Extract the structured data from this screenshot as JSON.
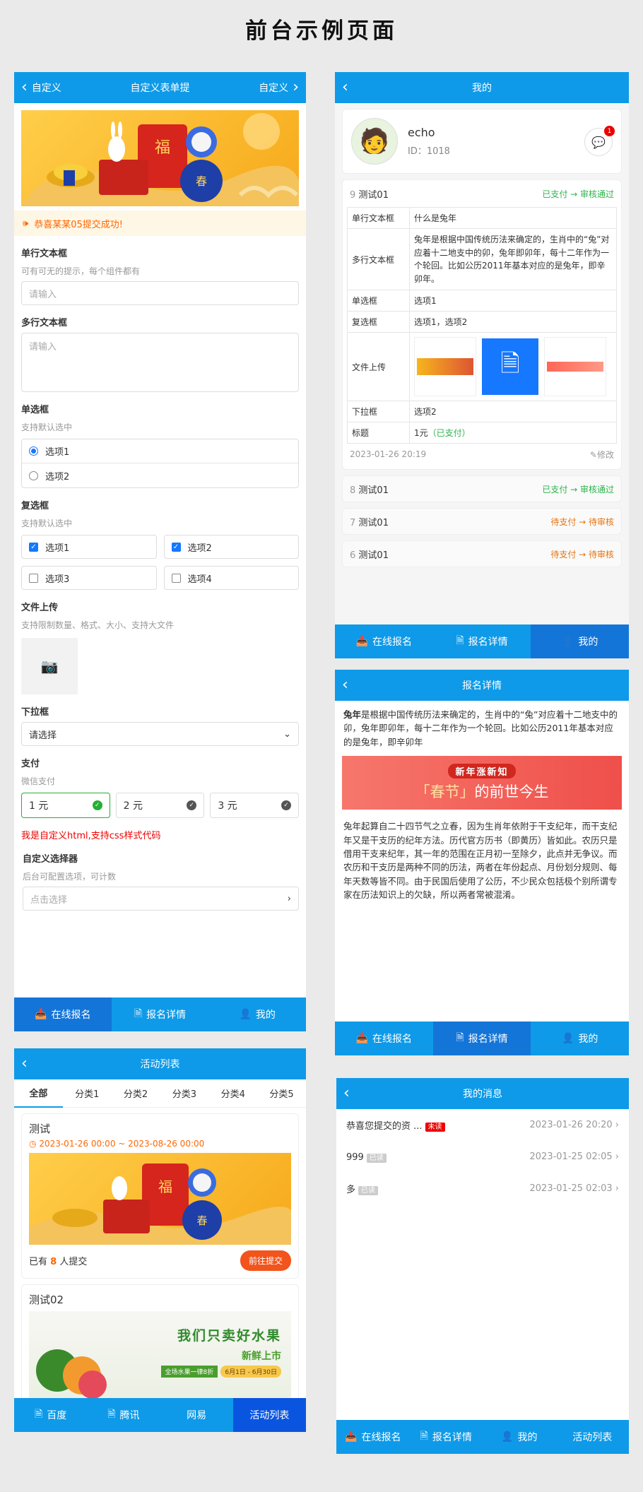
{
  "page_title": "前台示例页面",
  "form": {
    "back_label": "自定义",
    "title": "自定义表单提",
    "right_label": "自定义",
    "notice": "恭喜某某05提交成功!",
    "single_label": "单行文本框",
    "single_hint": "可有可无的提示，每个组件都有",
    "single_placeholder": "请输入",
    "multi_label": "多行文本框",
    "multi_placeholder": "请输入",
    "radio_label": "单选框",
    "radio_hint": "支持默认选中",
    "radio_options": [
      "选项1",
      "选项2"
    ],
    "check_label": "复选框",
    "check_hint": "支持默认选中",
    "check_options": [
      "选项1",
      "选项2",
      "选项3",
      "选项4"
    ],
    "upload_label": "文件上传",
    "upload_hint": "支持限制数量、格式、大小、支持大文件",
    "select_label": "下拉框",
    "select_placeholder": "请选择",
    "pay_label": "支付",
    "pay_hint": "微信支付",
    "pay_options": [
      "1 元",
      "2 元",
      "3 元"
    ],
    "custom_html": "我是自定义html,支持css样式代码",
    "picker_label": "自定义选择器",
    "picker_hint": "后台可配置选项，可计数",
    "picker_placeholder": "点击选择",
    "tabbar": [
      "在线报名",
      "报名详情",
      "我的"
    ]
  },
  "mine": {
    "title": "我的",
    "user_name": "echo",
    "user_id": "ID：1018",
    "msg_badge": "1",
    "entry1": {
      "num": "9",
      "name": "测试01",
      "status": "已支付 → 审核通过",
      "rows": [
        {
          "k": "单行文本框",
          "v": "什么是兔年"
        },
        {
          "k": "多行文本框",
          "v": "兔年是根据中国传统历法来确定的，生肖中的“兔”对应着十二地支中的卯，兔年即卯年，每十二年作为一个轮回。比如公历2011年基本对应的是兔年，即辛卯年。"
        },
        {
          "k": "单选框",
          "v": "选项1"
        },
        {
          "k": "复选框",
          "v": "选项1，选项2"
        },
        {
          "k": "文件上传",
          "v": ""
        },
        {
          "k": "下拉框",
          "v": "选项2"
        },
        {
          "k": "标题",
          "v": "1元",
          "extra": "（已支付）"
        }
      ],
      "date": "2023-01-26 20:19",
      "edit": "修改"
    },
    "entries": [
      {
        "num": "8",
        "name": "测试01",
        "status": "已支付 → 审核通过",
        "color": "green"
      },
      {
        "num": "7",
        "name": "测试01",
        "status": "待支付 → 待审核",
        "color": "orange"
      },
      {
        "num": "6",
        "name": "测试01",
        "status": "待支付 → 待审核",
        "color": "orange"
      }
    ],
    "tabbar": [
      "在线报名",
      "报名详情",
      "我的"
    ]
  },
  "detail": {
    "title": "报名详情",
    "intro_bold": "兔年",
    "intro": "是根据中国传统历法来确定的，生肖中的“兔”对应着十二地支中的卯，兔年即卯年，每十二年作为一个轮回。比如公历2011年基本对应的是兔年，即辛卯年",
    "banner_top": "新年涨新知",
    "banner_main1": "「春节」",
    "banner_main2": "的前世今生",
    "body": "兔年起算自二十四节气之立春，因为生肖年依附于干支纪年，而干支纪年又是干支历的纪年方法。历代官方历书（即黄历）皆如此。农历只是借用干支来纪年，其一年的范围在正月初一至除夕，此点并无争议。而农历和干支历是两种不同的历法，两者在年份起点、月份划分规则、每年天数等皆不同。由于民国后使用了公历，不少民众包括极个别所谓专家在历法知识上的欠缺，所以两者常被混淆。",
    "tabbar": [
      "在线报名",
      "报名详情",
      "我的"
    ]
  },
  "activity": {
    "title": "活动列表",
    "tabs": [
      "全部",
      "分类1",
      "分类2",
      "分类3",
      "分类4",
      "分类5"
    ],
    "item1_title": "测试",
    "item1_date": "2023-01-26 00:00 ~ 2023-08-26 00:00",
    "item1_count_pre": "已有",
    "item1_count": "8",
    "item1_count_post": "人提交",
    "item1_btn": "前往提交",
    "item2_title": "测试02",
    "fruit_main": "我们只卖好水果",
    "fruit_sub": "新鲜上市",
    "fruit_promo": "全场水果一律8折",
    "fruit_date": "6月1日 - 6月30日",
    "tabbar": [
      "百度",
      "腾讯",
      "网易",
      "活动列表"
    ]
  },
  "messages": {
    "title": "我的消息",
    "items": [
      {
        "text": "恭喜您提交的资 ...",
        "tag": "未读",
        "date": "2023-01-26 20:20"
      },
      {
        "text": "999",
        "tag": "已读",
        "date": "2023-01-25 02:05"
      },
      {
        "text": "多",
        "tag": "已读",
        "date": "2023-01-25 02:03"
      }
    ],
    "tabbar": [
      "在线报名",
      "报名详情",
      "我的",
      "活动列表"
    ]
  },
  "colors": {
    "primary": "#0e9ae8",
    "active_tab": "#1475d8",
    "green": "#2bb34b",
    "orange": "#e8730c",
    "red": "#e00000"
  }
}
